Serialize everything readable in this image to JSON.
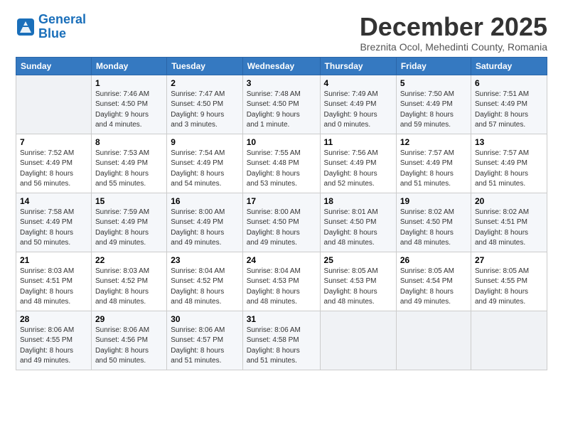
{
  "logo": {
    "line1": "General",
    "line2": "Blue"
  },
  "title": "December 2025",
  "subtitle": "Breznita Ocol, Mehedinti County, Romania",
  "weekdays": [
    "Sunday",
    "Monday",
    "Tuesday",
    "Wednesday",
    "Thursday",
    "Friday",
    "Saturday"
  ],
  "weeks": [
    [
      {
        "day": "",
        "detail": ""
      },
      {
        "day": "1",
        "detail": "Sunrise: 7:46 AM\nSunset: 4:50 PM\nDaylight: 9 hours\nand 4 minutes."
      },
      {
        "day": "2",
        "detail": "Sunrise: 7:47 AM\nSunset: 4:50 PM\nDaylight: 9 hours\nand 3 minutes."
      },
      {
        "day": "3",
        "detail": "Sunrise: 7:48 AM\nSunset: 4:50 PM\nDaylight: 9 hours\nand 1 minute."
      },
      {
        "day": "4",
        "detail": "Sunrise: 7:49 AM\nSunset: 4:49 PM\nDaylight: 9 hours\nand 0 minutes."
      },
      {
        "day": "5",
        "detail": "Sunrise: 7:50 AM\nSunset: 4:49 PM\nDaylight: 8 hours\nand 59 minutes."
      },
      {
        "day": "6",
        "detail": "Sunrise: 7:51 AM\nSunset: 4:49 PM\nDaylight: 8 hours\nand 57 minutes."
      }
    ],
    [
      {
        "day": "7",
        "detail": "Sunrise: 7:52 AM\nSunset: 4:49 PM\nDaylight: 8 hours\nand 56 minutes."
      },
      {
        "day": "8",
        "detail": "Sunrise: 7:53 AM\nSunset: 4:49 PM\nDaylight: 8 hours\nand 55 minutes."
      },
      {
        "day": "9",
        "detail": "Sunrise: 7:54 AM\nSunset: 4:49 PM\nDaylight: 8 hours\nand 54 minutes."
      },
      {
        "day": "10",
        "detail": "Sunrise: 7:55 AM\nSunset: 4:48 PM\nDaylight: 8 hours\nand 53 minutes."
      },
      {
        "day": "11",
        "detail": "Sunrise: 7:56 AM\nSunset: 4:49 PM\nDaylight: 8 hours\nand 52 minutes."
      },
      {
        "day": "12",
        "detail": "Sunrise: 7:57 AM\nSunset: 4:49 PM\nDaylight: 8 hours\nand 51 minutes."
      },
      {
        "day": "13",
        "detail": "Sunrise: 7:57 AM\nSunset: 4:49 PM\nDaylight: 8 hours\nand 51 minutes."
      }
    ],
    [
      {
        "day": "14",
        "detail": "Sunrise: 7:58 AM\nSunset: 4:49 PM\nDaylight: 8 hours\nand 50 minutes."
      },
      {
        "day": "15",
        "detail": "Sunrise: 7:59 AM\nSunset: 4:49 PM\nDaylight: 8 hours\nand 49 minutes."
      },
      {
        "day": "16",
        "detail": "Sunrise: 8:00 AM\nSunset: 4:49 PM\nDaylight: 8 hours\nand 49 minutes."
      },
      {
        "day": "17",
        "detail": "Sunrise: 8:00 AM\nSunset: 4:50 PM\nDaylight: 8 hours\nand 49 minutes."
      },
      {
        "day": "18",
        "detail": "Sunrise: 8:01 AM\nSunset: 4:50 PM\nDaylight: 8 hours\nand 48 minutes."
      },
      {
        "day": "19",
        "detail": "Sunrise: 8:02 AM\nSunset: 4:50 PM\nDaylight: 8 hours\nand 48 minutes."
      },
      {
        "day": "20",
        "detail": "Sunrise: 8:02 AM\nSunset: 4:51 PM\nDaylight: 8 hours\nand 48 minutes."
      }
    ],
    [
      {
        "day": "21",
        "detail": "Sunrise: 8:03 AM\nSunset: 4:51 PM\nDaylight: 8 hours\nand 48 minutes."
      },
      {
        "day": "22",
        "detail": "Sunrise: 8:03 AM\nSunset: 4:52 PM\nDaylight: 8 hours\nand 48 minutes."
      },
      {
        "day": "23",
        "detail": "Sunrise: 8:04 AM\nSunset: 4:52 PM\nDaylight: 8 hours\nand 48 minutes."
      },
      {
        "day": "24",
        "detail": "Sunrise: 8:04 AM\nSunset: 4:53 PM\nDaylight: 8 hours\nand 48 minutes."
      },
      {
        "day": "25",
        "detail": "Sunrise: 8:05 AM\nSunset: 4:53 PM\nDaylight: 8 hours\nand 48 minutes."
      },
      {
        "day": "26",
        "detail": "Sunrise: 8:05 AM\nSunset: 4:54 PM\nDaylight: 8 hours\nand 49 minutes."
      },
      {
        "day": "27",
        "detail": "Sunrise: 8:05 AM\nSunset: 4:55 PM\nDaylight: 8 hours\nand 49 minutes."
      }
    ],
    [
      {
        "day": "28",
        "detail": "Sunrise: 8:06 AM\nSunset: 4:55 PM\nDaylight: 8 hours\nand 49 minutes."
      },
      {
        "day": "29",
        "detail": "Sunrise: 8:06 AM\nSunset: 4:56 PM\nDaylight: 8 hours\nand 50 minutes."
      },
      {
        "day": "30",
        "detail": "Sunrise: 8:06 AM\nSunset: 4:57 PM\nDaylight: 8 hours\nand 51 minutes."
      },
      {
        "day": "31",
        "detail": "Sunrise: 8:06 AM\nSunset: 4:58 PM\nDaylight: 8 hours\nand 51 minutes."
      },
      {
        "day": "",
        "detail": ""
      },
      {
        "day": "",
        "detail": ""
      },
      {
        "day": "",
        "detail": ""
      }
    ]
  ]
}
